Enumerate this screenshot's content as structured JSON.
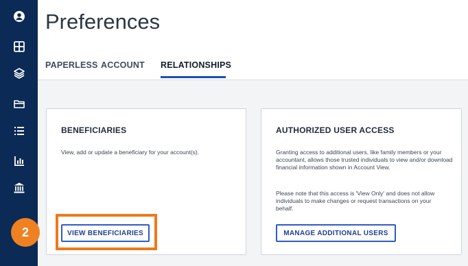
{
  "page": {
    "title": "Preferences"
  },
  "sidebar": {
    "items": [
      {
        "icon": "user-circle-icon"
      },
      {
        "icon": "grid-icon"
      },
      {
        "icon": "layers-icon"
      },
      {
        "icon": "folder-icon"
      },
      {
        "icon": "list-icon"
      },
      {
        "icon": "bar-chart-icon"
      },
      {
        "icon": "bank-icon"
      }
    ]
  },
  "tabs": [
    {
      "label": "PAPERLESS",
      "active": false
    },
    {
      "label": "ACCOUNT",
      "active": false
    },
    {
      "label": "RELATIONSHIPS",
      "active": true
    }
  ],
  "cards": {
    "beneficiaries": {
      "title": "BENEFICIARIES",
      "text": "View, add or update a beneficiary for your account(s).",
      "button": "VIEW BENEFICIARIES"
    },
    "authorized": {
      "title": "AUTHORIZED USER ACCESS",
      "text1": "Granting access to additional users, like family members or your accountant, allows those trusted individuals to view and/or download financial information shown in Account View.",
      "text2": "Please note that this access is 'View Only' and does not allow individuals to make changes or request transactions on your behalf.",
      "button": "MANAGE ADDITIONAL USERS"
    }
  },
  "annotation": {
    "step": "2",
    "color": "#ec7a1c"
  },
  "colors": {
    "sidebar": "#0b2a55",
    "accent": "#1a4fb8",
    "highlight": "#ec7a1c"
  }
}
